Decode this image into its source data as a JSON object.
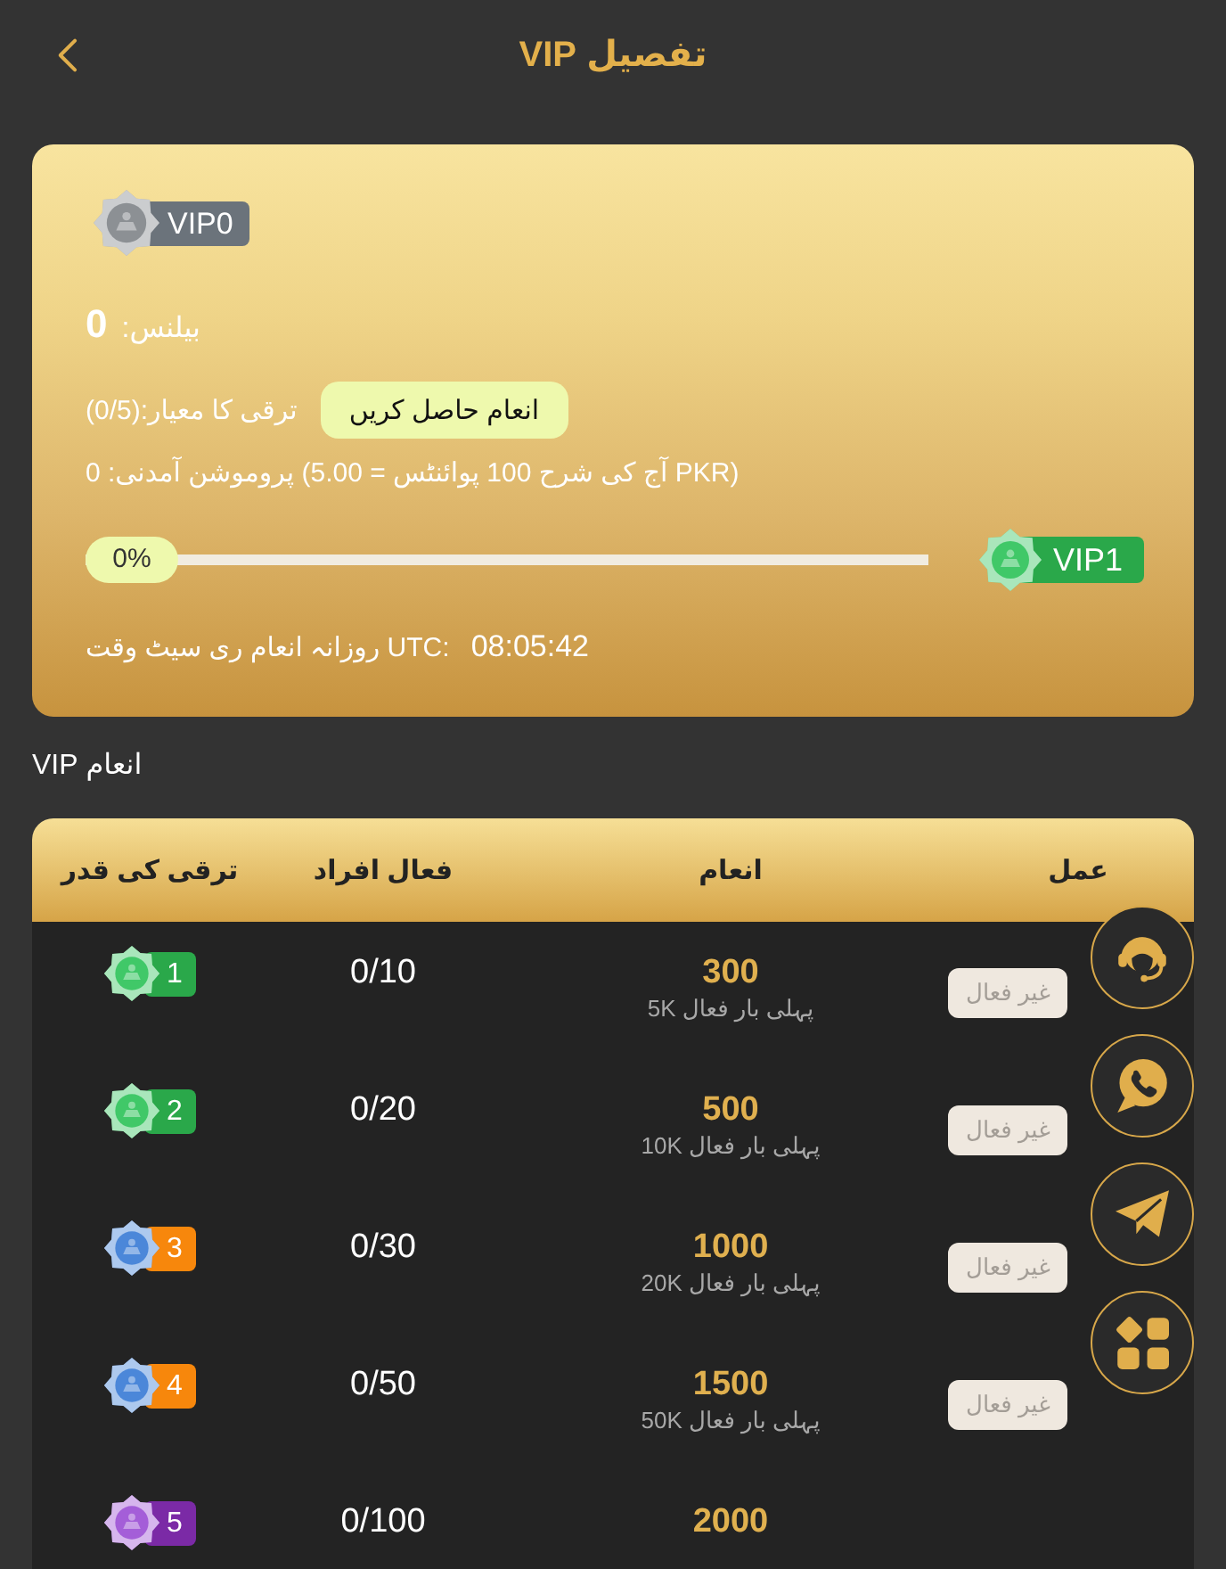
{
  "header": {
    "title": "تفصیل VIP"
  },
  "vip_card": {
    "current_badge": {
      "label": "VIP0",
      "color": "#6b737b",
      "gem": {
        "color": "#8c9094"
      }
    },
    "balance": {
      "label": "بیلنس:",
      "value": "0"
    },
    "criterion": "ترقی کا معیار:(0/5)",
    "claim_button": {
      "label": "انعام حاصل کریں"
    },
    "promotion": "پروموشن آمدنی: 0 (آج کی شرح 100 پوائنٹس = 5.00 PKR)",
    "progress": {
      "level": 0,
      "label": "0%"
    },
    "next_badge": {
      "label": "VIP1",
      "color": "#2aa84a",
      "gem": {
        "color": "#40c868"
      }
    },
    "reset": {
      "label": "روزانہ انعام ری سیٹ وقت UTC:",
      "time": "08:05:42"
    }
  },
  "rewards_title": "انعام VIP",
  "table": {
    "columns": [
      "عمل",
      "انعام",
      "فعال افراد",
      "ترقی کی قدر"
    ],
    "rows": [
      {
        "action": {
          "label": "غیر فعال",
          "disabled": true
        },
        "reward": "300",
        "note": "پہلی بار فعال 5K",
        "members": "0/10",
        "badge": {
          "label": "1",
          "color": "#2aa84a"
        },
        "gem": {
          "color": "#40c868"
        }
      },
      {
        "action": {
          "label": "غیر فعال",
          "disabled": true
        },
        "reward": "500",
        "note": "پہلی بار فعال 10K",
        "members": "0/20",
        "badge": {
          "label": "2",
          "color": "#2aa84a"
        },
        "gem": {
          "color": "#40c868"
        }
      },
      {
        "action": {
          "label": "غیر فعال",
          "disabled": true
        },
        "reward": "1000",
        "note": "پہلی بار فعال 20K",
        "members": "0/30",
        "badge": {
          "label": "3",
          "color": "#f7870c"
        },
        "gem": {
          "color": "#4b87d9"
        }
      },
      {
        "action": {
          "label": "غیر فعال",
          "disabled": true
        },
        "reward": "1500",
        "note": "پہلی بار فعال 50K",
        "members": "0/50",
        "badge": {
          "label": "4",
          "color": "#f7870c"
        },
        "gem": {
          "color": "#4b87d9"
        }
      },
      {
        "reward": "2000",
        "members": "0/100",
        "badge": {
          "label": "5",
          "color": "#7b2aa6"
        },
        "gem": {
          "color": "#a45ed8"
        }
      }
    ]
  },
  "floating_buttons": [
    {
      "kind": "headset"
    },
    {
      "kind": "phone"
    },
    {
      "kind": "plane"
    },
    {
      "kind": "apps"
    }
  ]
}
